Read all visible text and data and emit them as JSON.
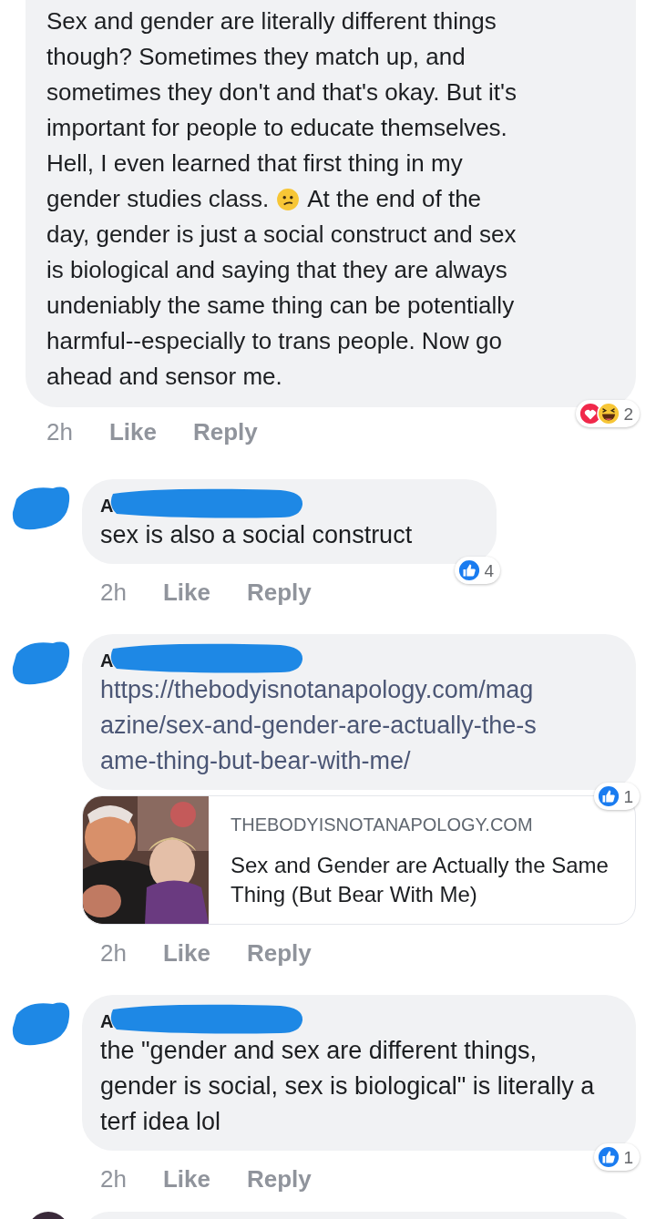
{
  "comments": [
    {
      "lines": [
        {
          "kind": "text",
          "text": "Sex and gender are literally different things"
        },
        {
          "kind": "text",
          "text": "though? Sometimes they match up, and"
        },
        {
          "kind": "text",
          "text": "sometimes they don't and that's okay. But it's"
        },
        {
          "kind": "text",
          "text": "important for people to educate themselves."
        },
        {
          "kind": "text",
          "text": "Hell, I even learned that first thing in my"
        },
        {
          "kind": "emoji",
          "before": "gender studies class.",
          "after": "At the end of the"
        },
        {
          "kind": "text",
          "text": "day, gender is just a social construct and sex"
        },
        {
          "kind": "text",
          "text": "is biological and saying that they are always"
        },
        {
          "kind": "text",
          "text": "undeniably the same thing can be potentially"
        },
        {
          "kind": "text",
          "text": "harmful--especially to trans people. Now go"
        },
        {
          "kind": "text",
          "text": "ahead and sensor me."
        }
      ],
      "time": "2h",
      "actions": [
        "Like",
        "Reply"
      ],
      "reactions": {
        "icons": [
          {
            "kind": "love"
          },
          {
            "kind": "haha"
          }
        ],
        "count": "2"
      }
    },
    {
      "author": "A",
      "text_parts": [
        "sex is also a social construct"
      ],
      "time": "2h",
      "actions": [
        "Like",
        "Reply"
      ],
      "reactions": {
        "icons": [
          {
            "kind": "like"
          }
        ],
        "count": "4"
      }
    },
    {
      "author": "A",
      "link": "https://thebodyisnotanapology.com/magazine/sex-and-gender-are-actually-the-same-thing-but-bear-with-me/",
      "preview": {
        "kind": "picture",
        "domain": "THEBODYISNOTANAPOLOGY.COM",
        "title": "Sex and Gender are Actually the Same Thing (But Bear With Me)"
      },
      "time": "2h",
      "actions": [
        "Like",
        "Reply"
      ],
      "reactions": {
        "icons": [
          {
            "kind": "like"
          }
        ],
        "count": "1"
      }
    },
    {
      "author": "A",
      "text_parts": [
        "the \"gender and sex are different things, gender is social, sex is biological\" is literally a terf idea lol"
      ],
      "time": "2h",
      "actions": [
        "Like",
        "Reply"
      ],
      "reactions": {
        "icons": [
          {
            "kind": "like"
          }
        ],
        "count": "1"
      }
    }
  ]
}
